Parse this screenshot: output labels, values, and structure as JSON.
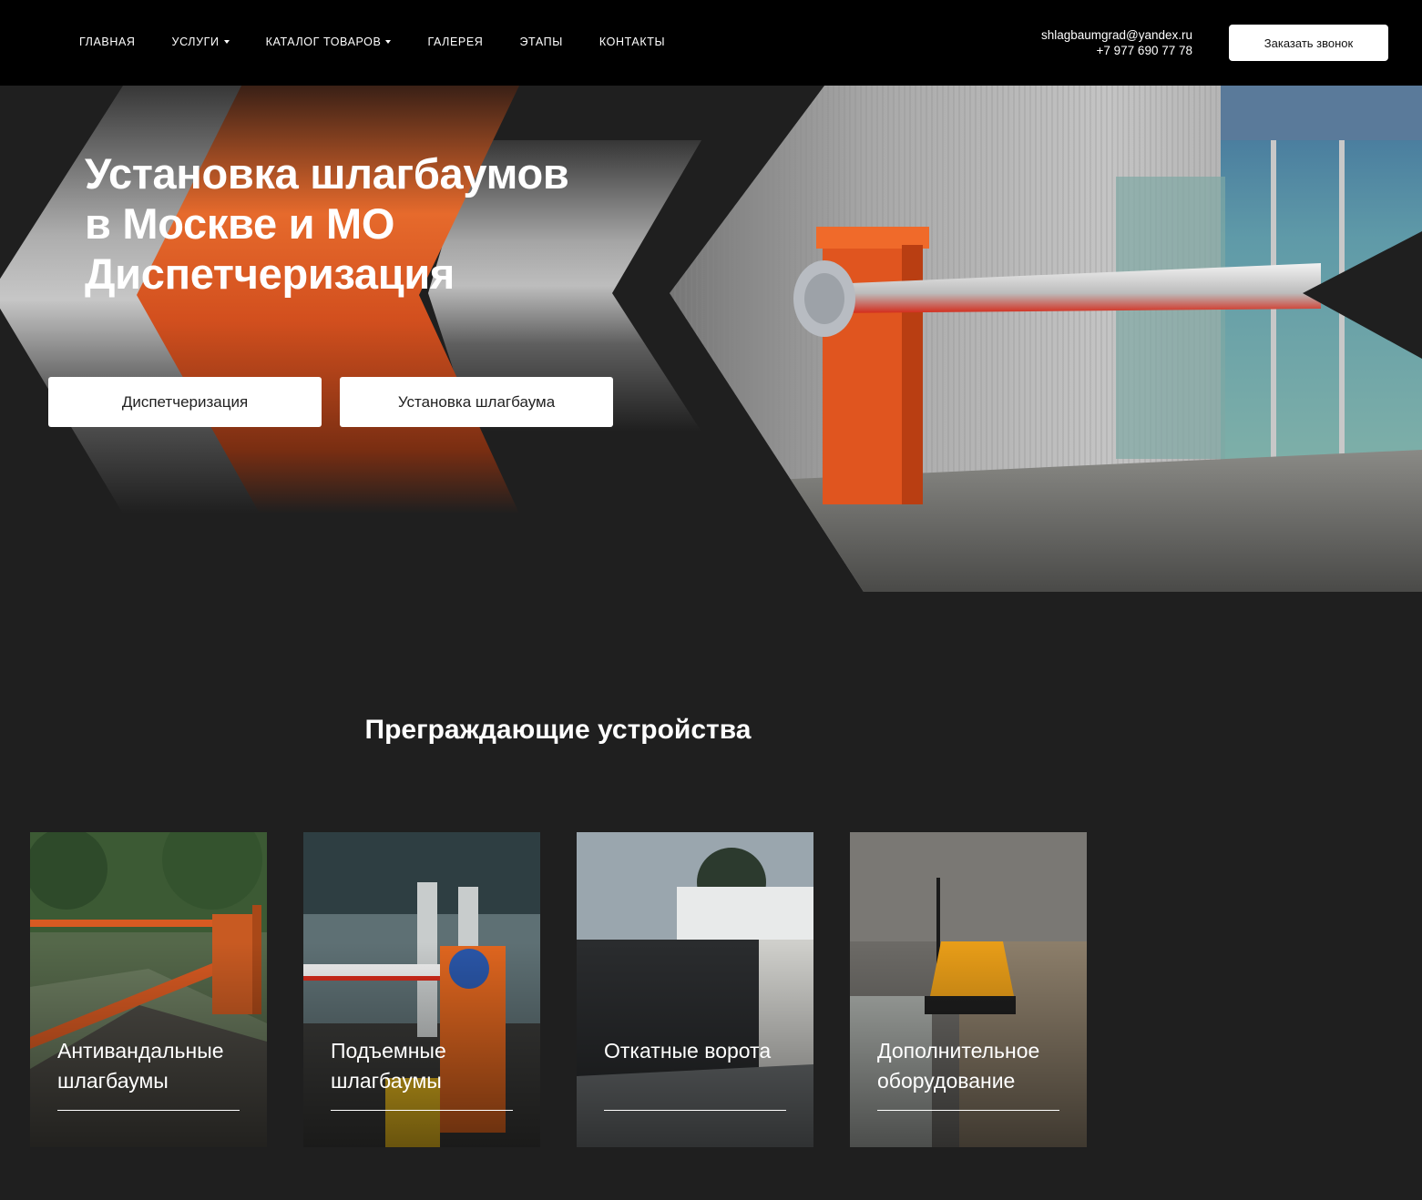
{
  "header": {
    "nav": [
      {
        "label": "Главная",
        "dropdown": false
      },
      {
        "label": "Услуги",
        "dropdown": true
      },
      {
        "label": "Каталог товаров",
        "dropdown": true
      },
      {
        "label": "Галерея",
        "dropdown": false
      },
      {
        "label": "Этапы",
        "dropdown": false
      },
      {
        "label": "Контакты",
        "dropdown": false
      }
    ],
    "email": "shlagbaumgrad@yandex.ru",
    "phone": "+7 977 690 77 78",
    "call_button": "Заказать звонок"
  },
  "hero": {
    "title_lines": [
      "Установка шлагбаумов",
      "в Москве и МО",
      "Диспетчеризация"
    ],
    "buttons": [
      "Диспетчеризация",
      "Установка шлагбаума"
    ]
  },
  "section": {
    "title": "Преграждающие устройства",
    "cards": [
      {
        "label": "Антивандальные шлагбаумы"
      },
      {
        "label": "Подъемные шлагбаумы"
      },
      {
        "label": "Откатные ворота"
      },
      {
        "label": "Дополнительное оборудование"
      }
    ]
  },
  "colors": {
    "header_bg": "#000000",
    "page_bg": "#1f1f1f",
    "accent_orange": "#e0551f",
    "button_bg": "#ffffff"
  }
}
